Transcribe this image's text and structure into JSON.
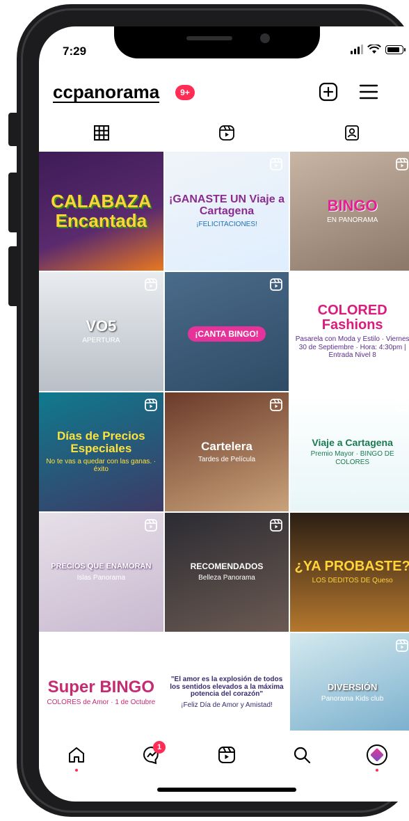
{
  "status_bar": {
    "time": "7:29"
  },
  "header": {
    "username": "ccpanorama",
    "notification_badge": "9+"
  },
  "tabs": [
    {
      "name": "posts-grid",
      "icon": "grid-icon",
      "active": true
    },
    {
      "name": "reels",
      "icon": "reels-icon",
      "active": false
    },
    {
      "name": "tagged",
      "icon": "tagged-user-icon",
      "active": false
    }
  ],
  "posts": [
    {
      "title": "CALABAZA Encantada",
      "sub": "",
      "pill": ""
    },
    {
      "title": "¡GANASTE UN Viaje a Cartagena",
      "sub": "¡FELICITACIONES!",
      "pill": ""
    },
    {
      "title": "BINGO",
      "sub": "EN PANORAMA",
      "pill": ""
    },
    {
      "title": "VO5",
      "sub": "APERTURA",
      "pill": ""
    },
    {
      "title": "",
      "sub": "",
      "pill": "¡CANTA BINGO!"
    },
    {
      "title": "COLORED Fashions",
      "sub": "Pasarela con Moda y Estilo · Viernes 30 de Septiembre · Hora: 4:30pm | Entrada Nivel 8",
      "pill": ""
    },
    {
      "title": "Días de Precios Especiales",
      "sub": "No te vas a quedar con las ganas. · éxito",
      "pill": ""
    },
    {
      "title": "Cartelera",
      "sub": "Tardes de Película",
      "pill": ""
    },
    {
      "title": "Viaje a Cartagena",
      "sub": "Premio Mayor · BINGO DE COLORES",
      "pill": ""
    },
    {
      "title": "PRECIOS QUE ENAMORAN",
      "sub": "Islas Panorama",
      "pill": ""
    },
    {
      "title": "RECOMENDADOS",
      "sub": "Belleza Panorama",
      "pill": ""
    },
    {
      "title": "¿YA PROBASTE?",
      "sub": "LOS DEDITOS DE Queso",
      "pill": ""
    },
    {
      "title": "Super BINGO",
      "sub": "COLORES de Amor · 1 de Octubre",
      "pill": ""
    },
    {
      "title": "\"El amor es la explosión de todos los sentidos elevados a la máxima potencia del corazón\"",
      "sub": "¡Feliz Día de Amor y Amistad!",
      "pill": ""
    },
    {
      "title": "DIVERSIÓN",
      "sub": "Panorama Kids club",
      "pill": ""
    }
  ],
  "reel_flags": [
    false,
    true,
    true,
    true,
    true,
    true,
    true,
    true,
    true,
    true,
    true,
    false,
    false,
    false,
    true
  ],
  "bottom_nav": {
    "items": [
      "home-icon",
      "messenger-icon",
      "reels-icon",
      "search-icon",
      "profile-avatar"
    ],
    "messages_badge": "1"
  },
  "colors": {
    "badge": "#ff2c55",
    "brand_magenta": "#e6339a"
  }
}
